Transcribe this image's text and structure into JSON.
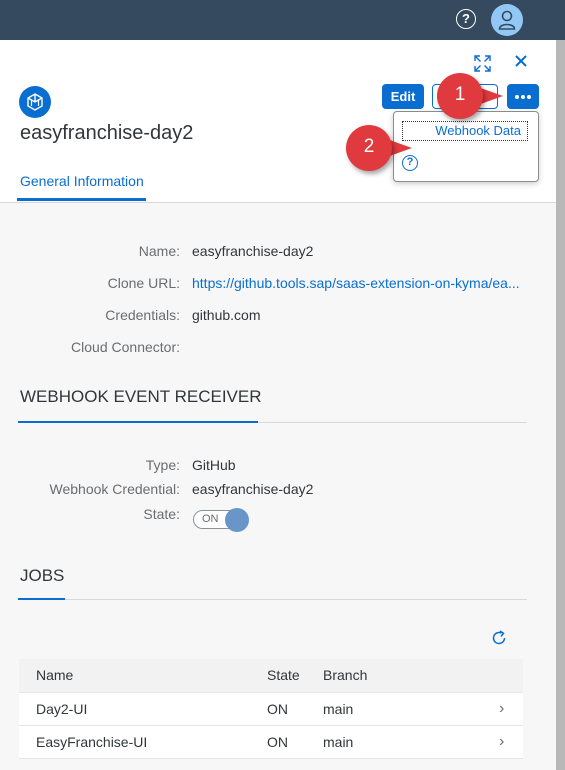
{
  "topbar": {
    "help_icon": "question-icon",
    "avatar_icon": "user-icon"
  },
  "header": {
    "title": "easyfranchise-day2",
    "edit_label": "Edit",
    "tab_label": "General Information"
  },
  "popover": {
    "item_label": "Webhook Data"
  },
  "annotations": {
    "badge1": "1",
    "badge2": "2",
    "color": "#e0393e"
  },
  "general": {
    "name_label": "Name:",
    "name_value": "easyfranchise-day2",
    "clone_label": "Clone URL:",
    "clone_value": "https://github.tools.sap/saas-extension-on-kyma/ea...",
    "cred_label": "Credentials:",
    "cred_value": "github.com",
    "cc_label": "Cloud Connector:"
  },
  "webhook": {
    "section_title": "WEBHOOK EVENT RECEIVER",
    "type_label": "Type:",
    "type_value": "GitHub",
    "cred_label": "Webhook Credential:",
    "cred_value": "easyfranchise-day2",
    "state_label": "State:",
    "state_value": "ON"
  },
  "jobs": {
    "section_title": "JOBS",
    "columns": [
      "Name",
      "State",
      "Branch"
    ],
    "rows": [
      {
        "name": "Day2-UI",
        "state": "ON",
        "branch": "main"
      },
      {
        "name": "EasyFranchise-UI",
        "state": "ON",
        "branch": "main"
      }
    ]
  },
  "colors": {
    "accent": "#0a6ed1",
    "shell": "#354a5f"
  }
}
